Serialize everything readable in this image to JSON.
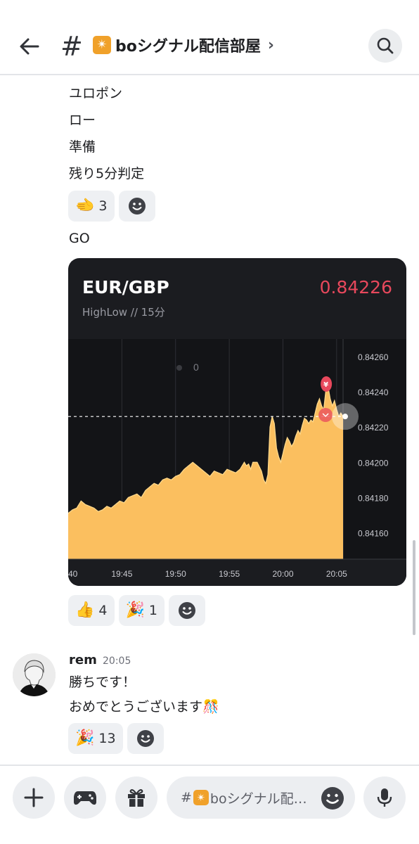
{
  "header": {
    "back_icon": "arrow-left-icon",
    "hash": "#",
    "channel_emoji": "✴",
    "channel_name": "boシグナル配信部屋",
    "chevron": "›",
    "search_icon": "search-icon"
  },
  "messages": {
    "lines": [
      "ユロポン",
      "ロー",
      "準備",
      "残り5分判定"
    ],
    "reactions1": [
      {
        "emoji": "🫲",
        "count": "3"
      }
    ],
    "go": "GO",
    "reactions2": [
      {
        "emoji": "👍",
        "count": "4"
      },
      {
        "emoji": "🎉",
        "count": "1"
      }
    ]
  },
  "card": {
    "pair": "EUR/GBP",
    "price": "0.84226",
    "sub": "HighLow  //  15分",
    "price_color": "#e8485c",
    "zero_label": "0",
    "marker_label": "¥"
  },
  "chart_data": {
    "type": "area",
    "x_tick_labels": [
      "40",
      "19:45",
      "19:50",
      "19:55",
      "20:00",
      "20:05"
    ],
    "y_tick_labels": [
      "0.84260",
      "0.84240",
      "0.84220",
      "0.84200",
      "0.84180",
      "0.84160"
    ],
    "ylim": [
      0.84145,
      0.8427
    ],
    "current_value": 0.84226,
    "x_range_minutes": [
      0,
      25.6
    ],
    "points": [
      [
        0,
        0.84171
      ],
      [
        0.4,
        0.84173
      ],
      [
        0.8,
        0.84174
      ],
      [
        1.2,
        0.84178
      ],
      [
        1.6,
        0.84176
      ],
      [
        2.0,
        0.84175
      ],
      [
        2.4,
        0.84174
      ],
      [
        2.8,
        0.84172
      ],
      [
        3.2,
        0.84173
      ],
      [
        3.6,
        0.84175
      ],
      [
        4.0,
        0.84174
      ],
      [
        4.4,
        0.84176
      ],
      [
        4.8,
        0.84178
      ],
      [
        5.2,
        0.84177
      ],
      [
        5.6,
        0.8418
      ],
      [
        6.0,
        0.84181
      ],
      [
        6.4,
        0.84182
      ],
      [
        6.8,
        0.8418
      ],
      [
        7.2,
        0.84184
      ],
      [
        7.6,
        0.84186
      ],
      [
        8.0,
        0.84188
      ],
      [
        8.4,
        0.84187
      ],
      [
        8.8,
        0.8419
      ],
      [
        9.2,
        0.84191
      ],
      [
        9.6,
        0.8419
      ],
      [
        10.0,
        0.84192
      ],
      [
        10.4,
        0.84193
      ],
      [
        10.8,
        0.84196
      ],
      [
        11.2,
        0.84198
      ],
      [
        11.6,
        0.842
      ],
      [
        12.0,
        0.84198
      ],
      [
        12.4,
        0.84196
      ],
      [
        12.8,
        0.84194
      ],
      [
        13.2,
        0.84192
      ],
      [
        13.6,
        0.84195
      ],
      [
        14.0,
        0.84194
      ],
      [
        14.4,
        0.84193
      ],
      [
        14.8,
        0.84196
      ],
      [
        15.2,
        0.84195
      ],
      [
        15.6,
        0.84194
      ],
      [
        16.0,
        0.84196
      ],
      [
        16.4,
        0.842
      ],
      [
        16.6,
        0.84198
      ],
      [
        16.8,
        0.84199
      ],
      [
        17.0,
        0.84196
      ],
      [
        17.2,
        0.842
      ],
      [
        17.6,
        0.842
      ],
      [
        18.0,
        0.84195
      ],
      [
        18.2,
        0.8419
      ],
      [
        18.4,
        0.84188
      ],
      [
        18.6,
        0.84193
      ],
      [
        18.8,
        0.8422
      ],
      [
        19.0,
        0.84226
      ],
      [
        19.2,
        0.84222
      ],
      [
        19.4,
        0.84208
      ],
      [
        19.6,
        0.84203
      ],
      [
        19.8,
        0.842
      ],
      [
        20.0,
        0.84205
      ],
      [
        20.2,
        0.8421
      ],
      [
        20.4,
        0.84214
      ],
      [
        20.6,
        0.84212
      ],
      [
        20.8,
        0.84209
      ],
      [
        21.0,
        0.84211
      ],
      [
        21.2,
        0.84215
      ],
      [
        21.4,
        0.84218
      ],
      [
        21.6,
        0.84216
      ],
      [
        21.8,
        0.84221
      ],
      [
        22.0,
        0.84225
      ],
      [
        22.2,
        0.84224
      ],
      [
        22.4,
        0.84222
      ],
      [
        22.6,
        0.84224
      ],
      [
        22.8,
        0.84223
      ],
      [
        23.0,
        0.84228
      ],
      [
        23.2,
        0.84233
      ],
      [
        23.4,
        0.84236
      ],
      [
        23.6,
        0.84232
      ],
      [
        23.8,
        0.8423
      ],
      [
        24.0,
        0.84241
      ],
      [
        24.1,
        0.84246
      ],
      [
        24.2,
        0.84243
      ],
      [
        24.4,
        0.84236
      ],
      [
        24.6,
        0.84232
      ],
      [
        24.8,
        0.84235
      ],
      [
        25.0,
        0.8423
      ],
      [
        25.2,
        0.84226
      ],
      [
        25.4,
        0.84228
      ],
      [
        25.6,
        0.84226
      ]
    ],
    "series_color": "#fbbf5f",
    "grid": true
  },
  "user_message": {
    "username": "rem",
    "time": "20:05",
    "line1": "勝ちです！",
    "line2": "おめでとうございます",
    "line2_emoji": "🎊",
    "reactions": [
      {
        "emoji": "🎉",
        "count": "13"
      }
    ]
  },
  "composer": {
    "hash": "#",
    "channel_emoji": "✴",
    "placeholder_text": "boシグナル配…"
  },
  "bottom_icons": [
    "plus-icon",
    "gamepad-icon",
    "gift-icon",
    "emoji-icon",
    "microphone-icon"
  ]
}
